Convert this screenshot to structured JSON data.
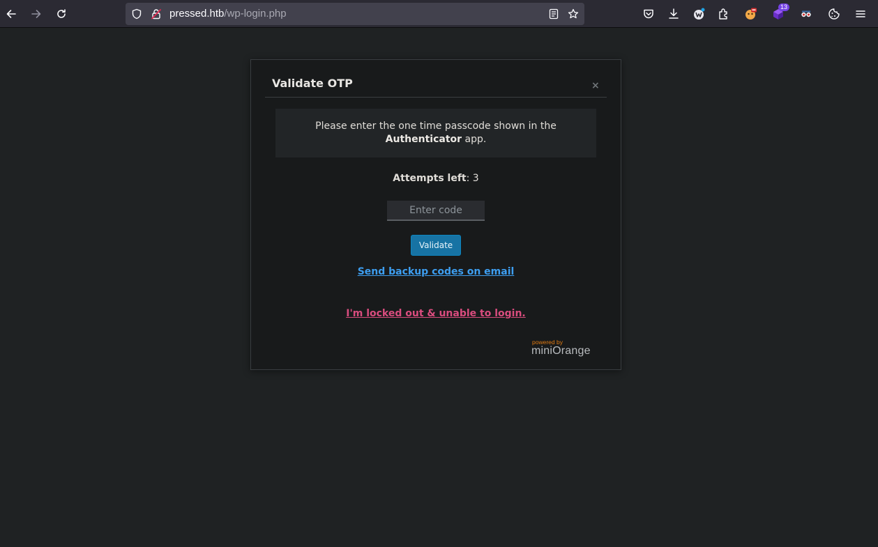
{
  "browser": {
    "url_host": "pressed.htb",
    "url_path": "/wp-login.php",
    "extension_badge_count": "13"
  },
  "modal": {
    "title": "Validate OTP",
    "close_symbol": "×",
    "instruction_prefix": "Please enter the one time passcode shown in the",
    "instruction_bold": "Authenticator",
    "instruction_suffix": " app.",
    "attempts_label": "Attempts left",
    "attempts_sep": ": ",
    "attempts_count": "3",
    "code_placeholder": "Enter code",
    "code_value": "",
    "validate_label": "Validate",
    "backup_link": "Send backup codes on email",
    "locked_link": "I'm locked out & unable to login.",
    "powered_by": "powered by",
    "brand": "miniOrange"
  },
  "colors": {
    "page_bg": "#1f2223",
    "modal_bg": "#181a1b",
    "validate_btn": "#1773a4",
    "backup_link": "#3d9ef0",
    "locked_link": "#d94c7e",
    "brand_orange": "#e07a12"
  }
}
